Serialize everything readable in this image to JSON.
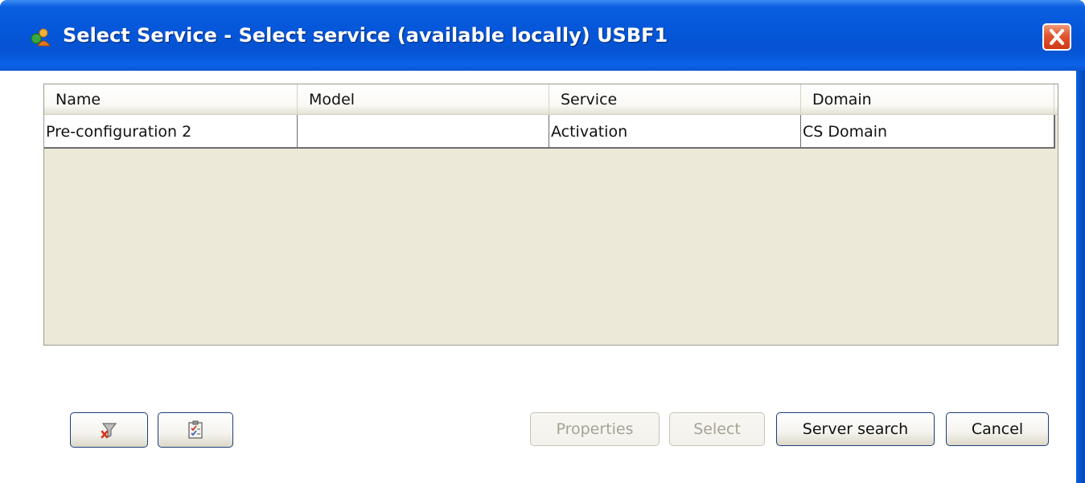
{
  "window": {
    "title": "Select Service - Select service (available locally) USBF1",
    "icons": {
      "app": "user-config-icon",
      "close": "close-icon"
    }
  },
  "table": {
    "columns": [
      "Name",
      "Model",
      "Service",
      "Domain"
    ],
    "rows": [
      {
        "name": "Pre-configuration 2",
        "model": "",
        "service": "Activation",
        "domain": "CS Domain"
      }
    ]
  },
  "buttons": {
    "filter_icon": "filter-clear-icon",
    "checklist_icon": "checklist-icon",
    "properties": "Properties",
    "select": "Select",
    "server_search": "Server search",
    "cancel": "Cancel"
  },
  "colors": {
    "titlebar": "#0556d8",
    "client_bg": "#ffffff",
    "grid_bg": "#ece9d8",
    "close": "#e0552f"
  }
}
